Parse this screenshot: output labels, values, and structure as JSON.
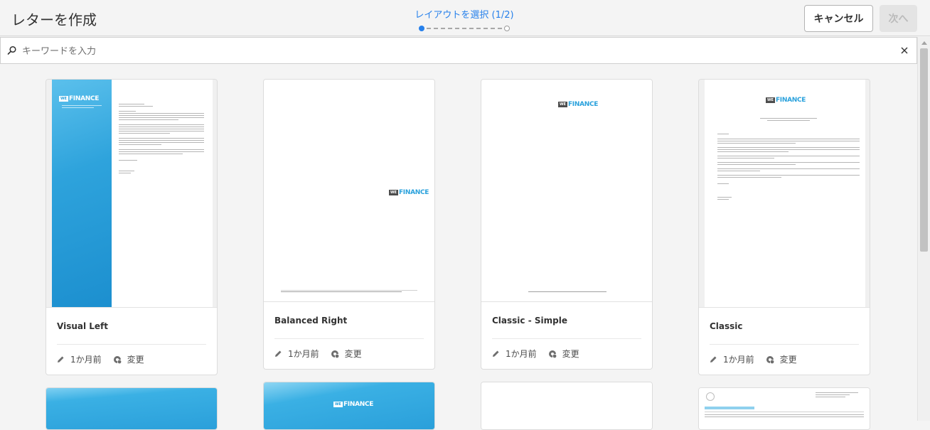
{
  "header": {
    "title": "レターを作成",
    "step_label": "レイアウトを選択 (1/2)",
    "cancel_label": "キャンセル",
    "next_label": "次へ"
  },
  "search": {
    "placeholder": "キーワードを入力"
  },
  "logo": {
    "box_text": "WE",
    "word_text": "FINANCE"
  },
  "cards": [
    {
      "name": "Visual Left",
      "modified": "1か月前",
      "change_label": "変更"
    },
    {
      "name": "Balanced Right",
      "modified": "1か月前",
      "change_label": "変更"
    },
    {
      "name": "Classic - Simple",
      "modified": "1か月前",
      "change_label": "変更"
    },
    {
      "name": "Classic",
      "modified": "1か月前",
      "change_label": "変更"
    }
  ],
  "colors": {
    "accent": "#2680eb",
    "brand_blue": "#29a1dc"
  }
}
